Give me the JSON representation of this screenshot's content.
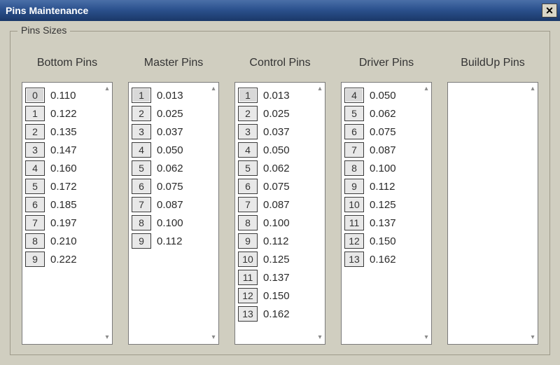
{
  "window": {
    "title": "Pins Maintenance",
    "close_label": "✕"
  },
  "groupbox": {
    "label": "Pins Sizes"
  },
  "columns": [
    {
      "header": "Bottom Pins",
      "rows": [
        {
          "idx": "0",
          "val": "0.110"
        },
        {
          "idx": "1",
          "val": "0.122"
        },
        {
          "idx": "2",
          "val": "0.135"
        },
        {
          "idx": "3",
          "val": "0.147"
        },
        {
          "idx": "4",
          "val": "0.160"
        },
        {
          "idx": "5",
          "val": "0.172"
        },
        {
          "idx": "6",
          "val": "0.185"
        },
        {
          "idx": "7",
          "val": "0.197"
        },
        {
          "idx": "8",
          "val": "0.210"
        },
        {
          "idx": "9",
          "val": "0.222"
        }
      ],
      "selected": 0
    },
    {
      "header": "Master Pins",
      "rows": [
        {
          "idx": "1",
          "val": "0.013"
        },
        {
          "idx": "2",
          "val": "0.025"
        },
        {
          "idx": "3",
          "val": "0.037"
        },
        {
          "idx": "4",
          "val": "0.050"
        },
        {
          "idx": "5",
          "val": "0.062"
        },
        {
          "idx": "6",
          "val": "0.075"
        },
        {
          "idx": "7",
          "val": "0.087"
        },
        {
          "idx": "8",
          "val": "0.100"
        },
        {
          "idx": "9",
          "val": "0.112"
        }
      ],
      "selected": 0
    },
    {
      "header": "Control Pins",
      "rows": [
        {
          "idx": "1",
          "val": "0.013"
        },
        {
          "idx": "2",
          "val": "0.025"
        },
        {
          "idx": "3",
          "val": "0.037"
        },
        {
          "idx": "4",
          "val": "0.050"
        },
        {
          "idx": "5",
          "val": "0.062"
        },
        {
          "idx": "6",
          "val": "0.075"
        },
        {
          "idx": "7",
          "val": "0.087"
        },
        {
          "idx": "8",
          "val": "0.100"
        },
        {
          "idx": "9",
          "val": "0.112"
        },
        {
          "idx": "10",
          "val": "0.125"
        },
        {
          "idx": "11",
          "val": "0.137"
        },
        {
          "idx": "12",
          "val": "0.150"
        },
        {
          "idx": "13",
          "val": "0.162"
        }
      ],
      "selected": 0
    },
    {
      "header": "Driver Pins",
      "rows": [
        {
          "idx": "4",
          "val": "0.050"
        },
        {
          "idx": "5",
          "val": "0.062"
        },
        {
          "idx": "6",
          "val": "0.075"
        },
        {
          "idx": "7",
          "val": "0.087"
        },
        {
          "idx": "8",
          "val": "0.100"
        },
        {
          "idx": "9",
          "val": "0.112"
        },
        {
          "idx": "10",
          "val": "0.125"
        },
        {
          "idx": "11",
          "val": "0.137"
        },
        {
          "idx": "12",
          "val": "0.150"
        },
        {
          "idx": "13",
          "val": "0.162"
        }
      ],
      "selected": 0
    },
    {
      "header": "BuildUp Pins",
      "rows": [],
      "selected": -1
    }
  ],
  "scroll": {
    "up": "▴",
    "down": "▾"
  }
}
